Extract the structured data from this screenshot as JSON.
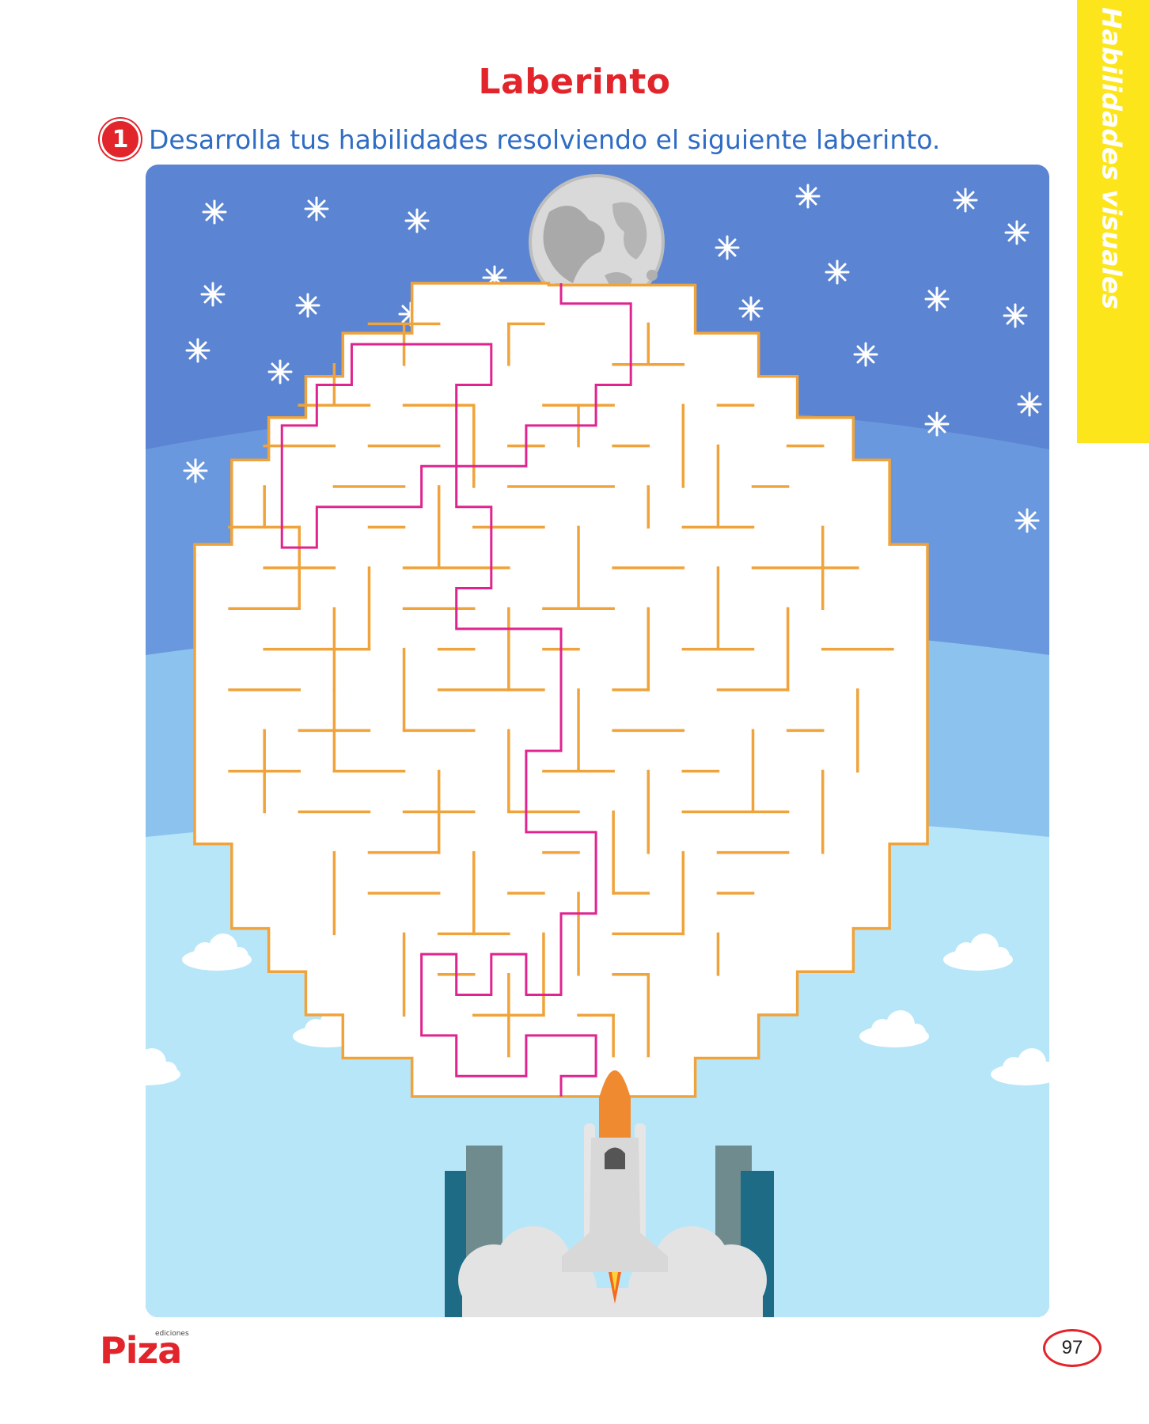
{
  "page": {
    "title": "Laberinto",
    "exercise_number": "1",
    "instruction": "Desarrolla tus habilidades resolviendo el siguiente laberinto.",
    "side_tab": "Habilidades visuales",
    "page_number": "97"
  },
  "publisher": {
    "small_text": "ediciones",
    "name": "Piza"
  },
  "colors": {
    "title": "#e2242b",
    "instruction": "#2f6cc4",
    "side_tab": "#fde51c",
    "maze_wall": "#f0a33a",
    "solution_path": "#e0248f",
    "sky_top": "#5b84d2",
    "sky_bottom": "#b8e6f9"
  },
  "icons": [
    "moon-icon",
    "star-icon",
    "cloud-icon",
    "space-shuttle-icon",
    "launch-tower-icon"
  ]
}
